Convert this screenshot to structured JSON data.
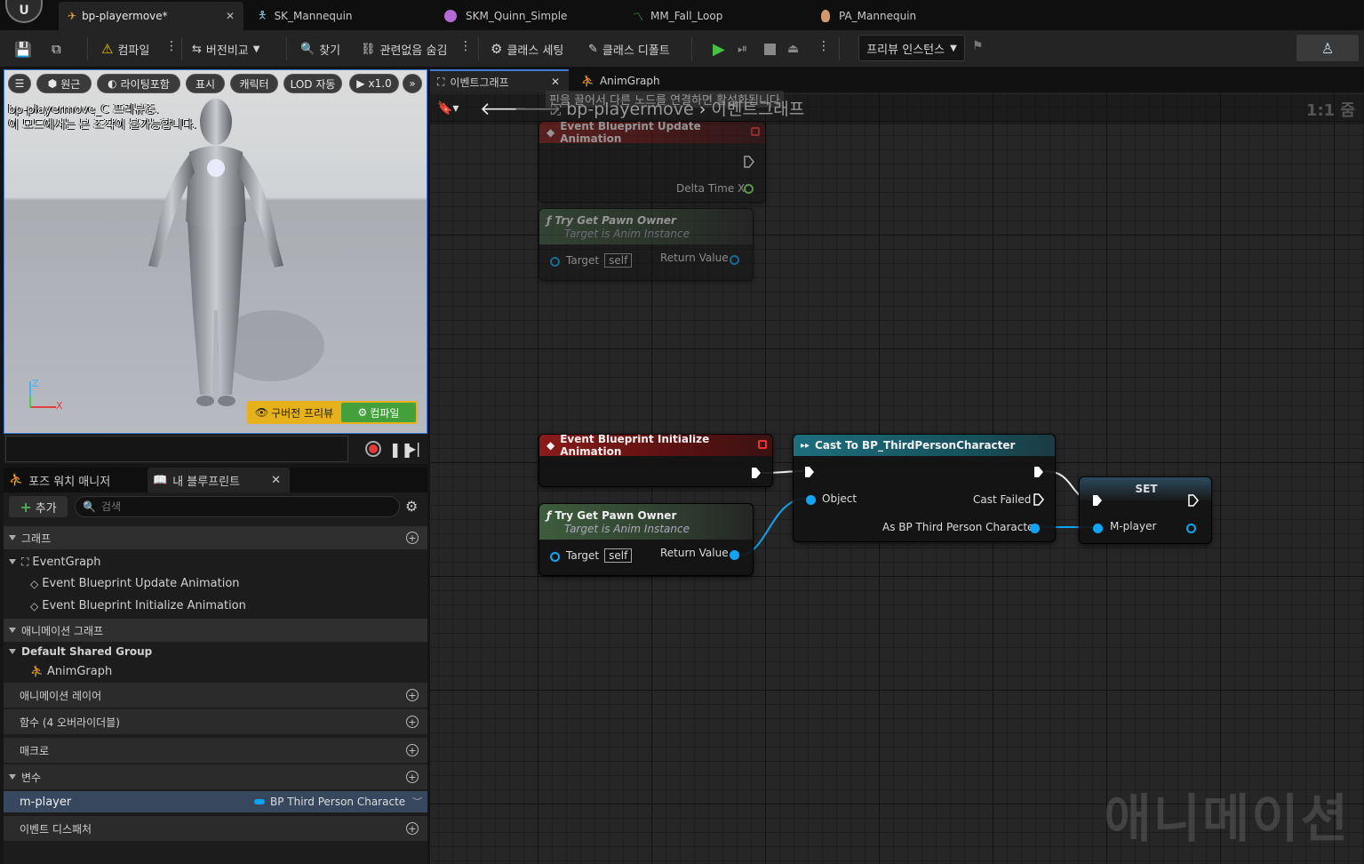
{
  "tabs": [
    {
      "label": "bp-playermove*",
      "active": true
    },
    {
      "label": "SK_Mannequin"
    },
    {
      "label": "SKM_Quinn_Simple"
    },
    {
      "label": "MM_Fall_Loop"
    },
    {
      "label": "PA_Mannequin"
    }
  ],
  "toolbar": {
    "compile": "컴파일",
    "diff": "버전비교",
    "find": "찾기",
    "hide_unrelated": "관련없음 숨김",
    "class_settings": "클래스 세팅",
    "class_defaults": "클래스 디폴트",
    "preview_instance": "프리뷰 인스턴스"
  },
  "viewport": {
    "buttons": [
      "원근",
      "라이팅포함",
      "표시",
      "캐릭터",
      "LOD 자동",
      "x1.0"
    ],
    "msg1": "bp-playermove_C 프리뷰중.",
    "msg2": "이 모드에서는 본 조작이 불가능합니다.",
    "old_preview": "구버전 프리뷰",
    "compile": "컴파일",
    "axis_z": "Z",
    "axis_x": "X"
  },
  "left_panel": {
    "tab1": "포즈 워치 매니저",
    "tab2": "내 블루프린트",
    "add": "추가",
    "search_placeholder": "검색",
    "sec_graph": "그래프",
    "event_graph": "EventGraph",
    "ev_update": "Event Blueprint Update Animation",
    "ev_init": "Event Blueprint Initialize Animation",
    "sec_anim_graph": "애니메이션 그래프",
    "default_group": "Default Shared Group",
    "anim_graph": "AnimGraph",
    "sec_anim_layer": "애니메이션 레이어",
    "sec_functions": "함수 (4 오버라이더블)",
    "sec_macro": "매크로",
    "sec_vars": "변수",
    "var_name": "m-player",
    "var_type": "BP Third Person Characte",
    "sec_dispatchers": "이벤트 디스패처"
  },
  "graph": {
    "tab_event": "이벤트그래프",
    "tab_anim": "AnimGraph",
    "crumb_root": "bp-playermove",
    "crumb_leaf": "이벤트그래프",
    "zoom": "1:1 줌",
    "ghost": "핀을 끌어서 다른 노드를 연결하면 활성화됩니다",
    "watermark": "애니메이션",
    "nodes": {
      "update_title": "Event Blueprint Update Animation",
      "delta": "Delta Time X",
      "pawn_title": "Try Get Pawn Owner",
      "pawn_sub": "Target is Anim Instance",
      "target": "Target",
      "self": "self",
      "return_value": "Return Value",
      "init_title": "Event Blueprint Initialize Animation",
      "cast_title": "Cast To BP_ThirdPersonCharacter",
      "object": "Object",
      "cast_failed": "Cast Failed",
      "as_bp": "As BP Third Person Character",
      "set_title": "SET",
      "m_player": "M-player"
    }
  },
  "colors": {
    "accent": "#3d7bd5",
    "exec": "#ffffff",
    "object_pin": "#0ea5f5",
    "compile_green": "#43a03a",
    "old_preview_yellow": "#e6b11a"
  }
}
